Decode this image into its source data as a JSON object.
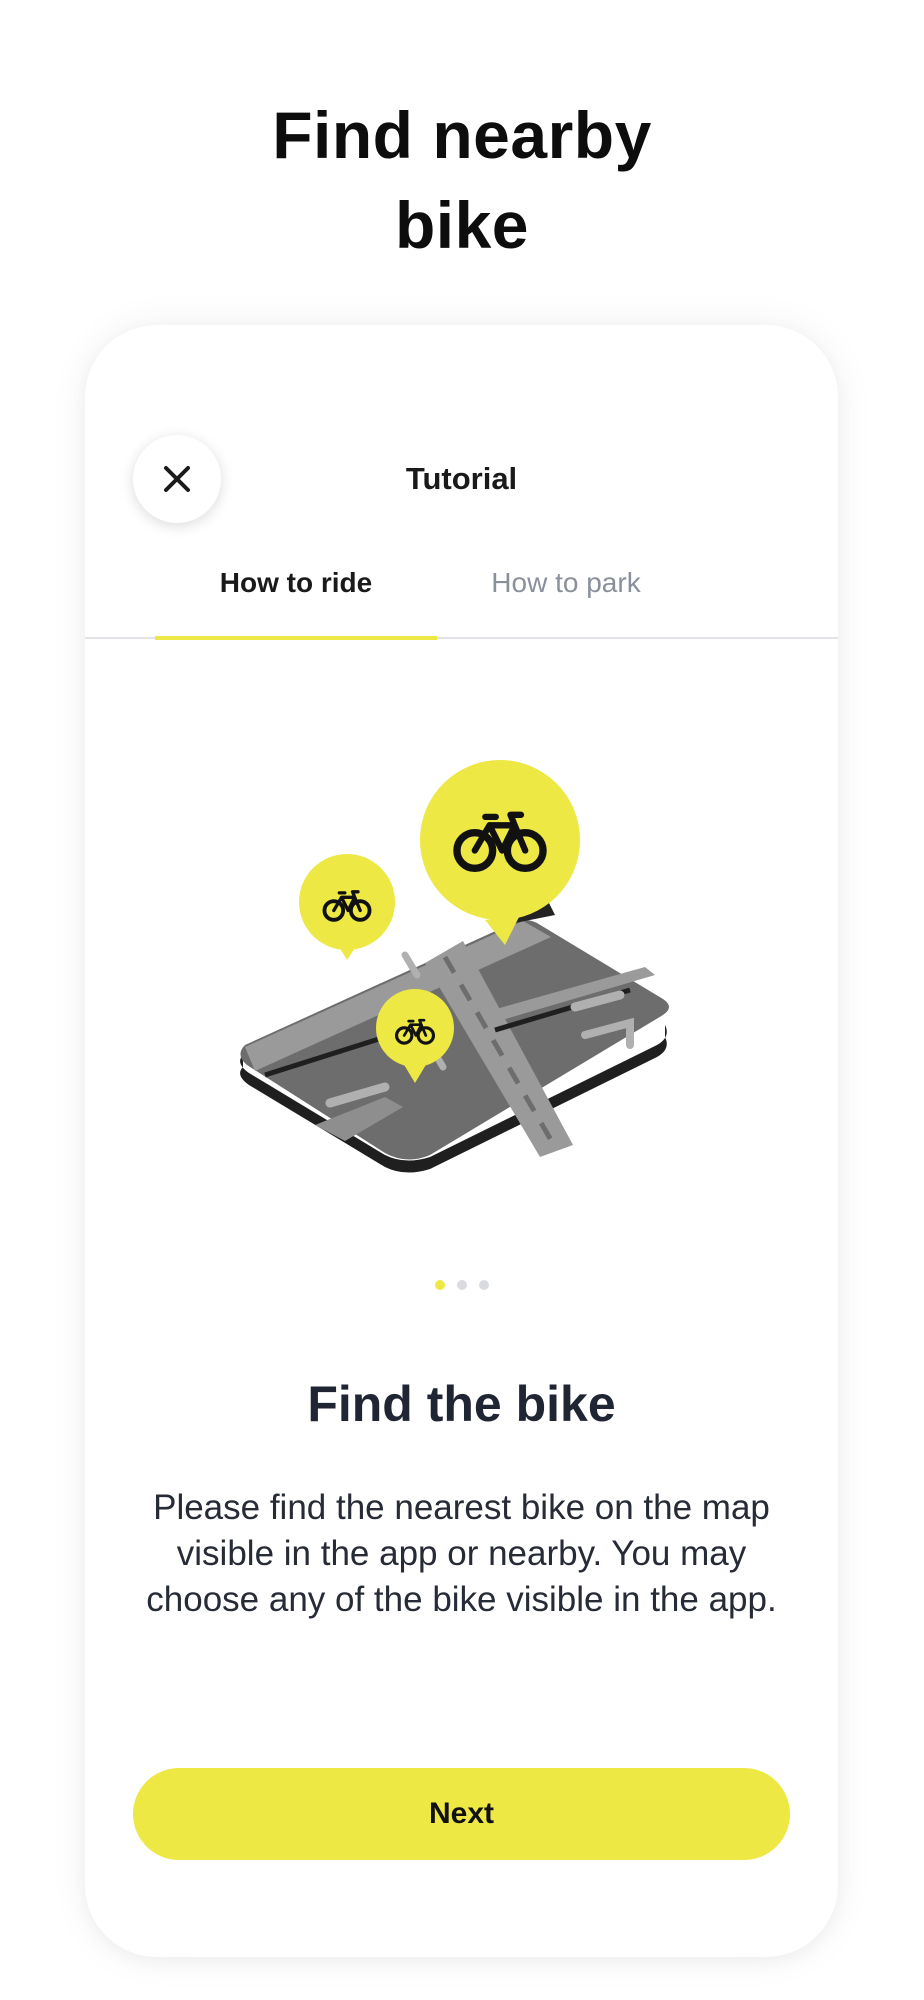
{
  "page": {
    "headline_line1": "Find nearby",
    "headline_line2": "bike"
  },
  "card": {
    "title": "Tutorial",
    "close_icon": "close-icon"
  },
  "tabs": [
    {
      "label": "How to ride",
      "active": true
    },
    {
      "label": "How to park",
      "active": false
    }
  ],
  "illustration": {
    "icons": [
      "map-icon",
      "bike-pin-icon"
    ]
  },
  "pagination": {
    "total": 3,
    "current": 1
  },
  "slide": {
    "title": "Find the bike",
    "description": "Please find the nearest bike on the map visible in the app or nearby. You may choose any of the bike visible in the app."
  },
  "actions": {
    "next_label": "Next"
  },
  "colors": {
    "accent": "#ede843",
    "text": "#1f2532",
    "muted": "#8a8f9c",
    "map_dark": "#232323",
    "map_gray": "#6b6b6b"
  }
}
